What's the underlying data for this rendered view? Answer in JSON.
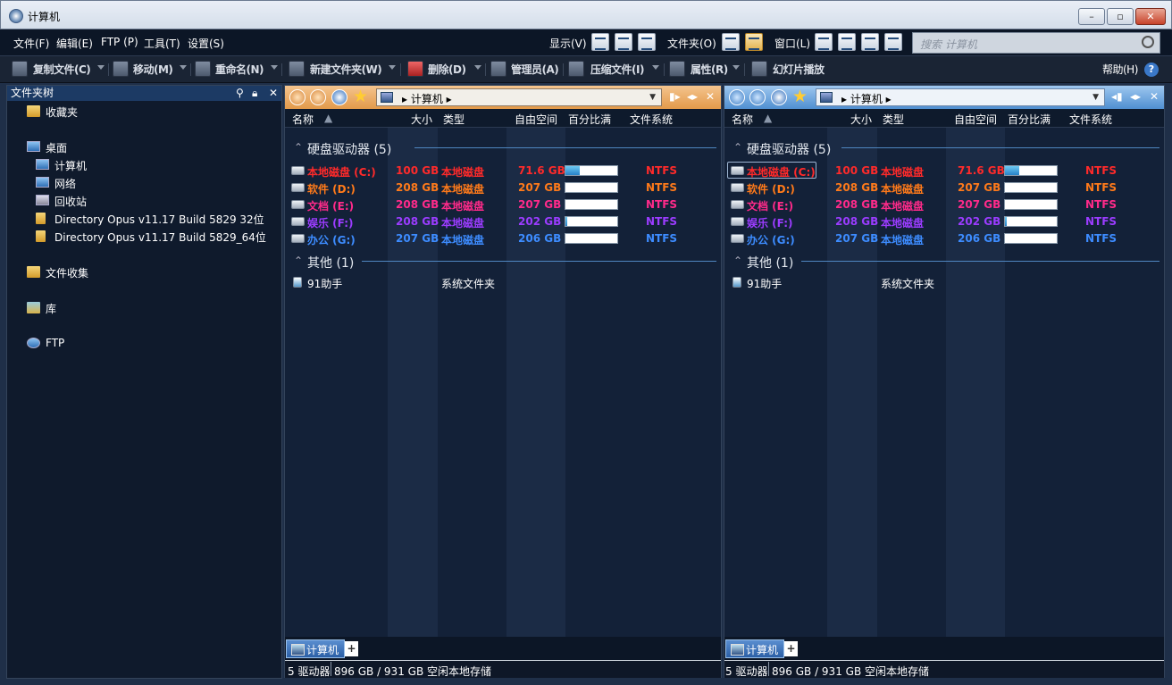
{
  "window": {
    "title": "计算机"
  },
  "menubar": {
    "items": [
      "文件(F)",
      "编辑(E)",
      "FTP (P)",
      "工具(T)",
      "设置(S)"
    ],
    "display_label": "显示(V)",
    "folder_label": "文件夹(O)",
    "window_label": "窗口(L)",
    "search_placeholder": "搜索 计算机"
  },
  "toolbar": {
    "copy": "复制文件(C)",
    "move": "移动(M)",
    "rename": "重命名(N)",
    "newfolder": "新建文件夹(W)",
    "delete": "删除(D)",
    "admin": "管理员(A)",
    "compress": "压缩文件(I)",
    "properties": "属性(R)",
    "slideshow": "幻灯片播放",
    "help": "帮助(H)"
  },
  "tree": {
    "header": "文件夹树",
    "favorites": "收藏夹",
    "desktop": "桌面",
    "computer": "计算机",
    "network": "网络",
    "recycle": "回收站",
    "dopus32": "Directory Opus v11.17 Build 5829 32位",
    "dopus64": "Directory Opus v11.17 Build 5829_64位",
    "collections": "文件收集",
    "library": "库",
    "ftp": "FTP"
  },
  "pane": {
    "path": "计算机",
    "columns": {
      "name": "名称",
      "size": "大小",
      "type": "类型",
      "free": "自由空间",
      "percent": "百分比满",
      "fs": "文件系统"
    },
    "group_drives": "硬盘驱动器 (5)",
    "group_other": "其他 (1)",
    "drives": [
      {
        "name": "本地磁盘 (C:)",
        "size": "100 GB",
        "type": "本地磁盘",
        "free": "71.6 GB",
        "used_fraction": 0.284,
        "fs": "NTFS",
        "color": "#ff2a2a"
      },
      {
        "name": "软件 (D:)",
        "size": "208 GB",
        "type": "本地磁盘",
        "free": "207 GB",
        "used_fraction": 0.005,
        "fs": "NTFS",
        "color": "#ff7a1a"
      },
      {
        "name": "文档 (E:)",
        "size": "208 GB",
        "type": "本地磁盘",
        "free": "207 GB",
        "used_fraction": 0.005,
        "fs": "NTFS",
        "color": "#ff2a8a"
      },
      {
        "name": "娱乐 (F:)",
        "size": "208 GB",
        "type": "本地磁盘",
        "free": "202 GB",
        "used_fraction": 0.03,
        "fs": "NTFS",
        "color": "#9b3cff"
      },
      {
        "name": "办公 (G:)",
        "size": "207 GB",
        "type": "本地磁盘",
        "free": "206 GB",
        "used_fraction": 0.005,
        "fs": "NTFS",
        "color": "#3d8cff"
      }
    ],
    "other": {
      "name": "91助手",
      "type": "系统文件夹"
    },
    "tab_label": "计算机",
    "tab_add": "+",
    "status_drives": "5 驱动器",
    "status_space": "896 GB / 931 GB 空闲本地存储"
  }
}
